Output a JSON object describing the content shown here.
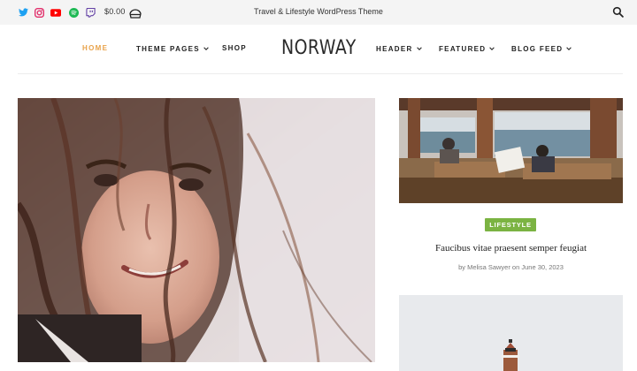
{
  "topbar": {
    "social_icons": [
      "twitter-icon",
      "instagram-icon",
      "youtube-icon",
      "spotify-icon",
      "twitch-icon"
    ],
    "cart_amount": "$0.00",
    "tagline": "Travel & Lifestyle WordPress Theme"
  },
  "header": {
    "logo": "NORWAY",
    "nav": [
      {
        "label": "HOME",
        "active": true
      },
      {
        "label": "THEME PAGES",
        "dropdown": true
      },
      {
        "label": "SHOP"
      },
      {
        "label": "HEADER",
        "dropdown": true
      },
      {
        "label": "FEATURED",
        "dropdown": true
      },
      {
        "label": "BLOG FEED",
        "dropdown": true
      }
    ]
  },
  "colors": {
    "accent": "#e8a24a",
    "badge": "#7bb342",
    "twitter": "#1da1f2",
    "instagram": "#e1306c",
    "youtube": "#ff0000",
    "spotify": "#1db954",
    "twitch": "#6441a5"
  },
  "side_post": {
    "category": "LIFESTYLE",
    "title": "Faucibus vitae praesent semper feugiat",
    "meta": "by Melisa Sawyer on June 30, 2023"
  }
}
